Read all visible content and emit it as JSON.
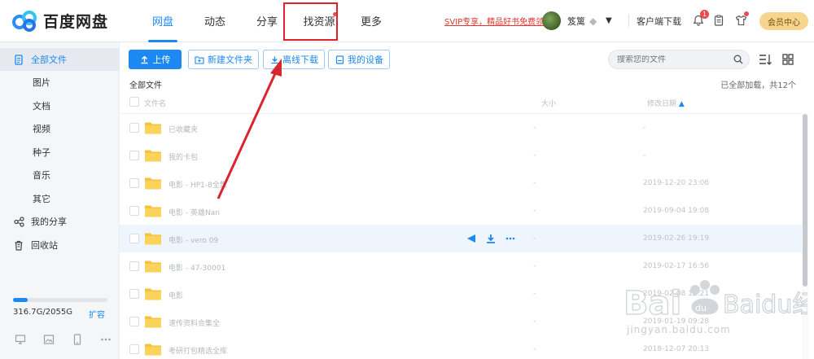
{
  "app": {
    "logo_text": "百度网盘"
  },
  "nav": {
    "items": [
      {
        "label": "网盘",
        "active": true
      },
      {
        "label": "动态"
      },
      {
        "label": "分享"
      },
      {
        "label": "找资源",
        "dot": true
      },
      {
        "label": "更多"
      }
    ]
  },
  "header": {
    "vip_promo": "SVIP专享，精品好书免费领",
    "username": "笈篱",
    "client_download": "客户端下载",
    "notification_count": "1",
    "vip_center": "会员中心"
  },
  "sidebar": {
    "items": [
      {
        "label": "全部文件",
        "active": true,
        "icon": "files-icon"
      },
      {
        "label": "图片",
        "sub": true
      },
      {
        "label": "文档",
        "sub": true
      },
      {
        "label": "视频",
        "sub": true
      },
      {
        "label": "种子",
        "sub": true
      },
      {
        "label": "音乐",
        "sub": true
      },
      {
        "label": "其它",
        "sub": true
      },
      {
        "label": "我的分享",
        "icon": "share-icon"
      },
      {
        "label": "回收站",
        "icon": "trash-icon"
      }
    ],
    "quota_text": "316.7G/2055G",
    "quota_fraction": 0.154,
    "expand_label": "扩容"
  },
  "toolbar": {
    "upload": "上传",
    "new_folder": "新建文件夹",
    "offline_download": "离线下载",
    "my_devices": "我的设备",
    "search_placeholder": "搜索您的文件"
  },
  "breadcrumb": "全部文件",
  "loaded_status": "已全部加载，共12个",
  "table": {
    "headers": {
      "name": "文件名",
      "size": "大小",
      "date": "修改日期"
    },
    "rows": [
      {
        "name": "已收藏夹",
        "size": "-",
        "date": "-"
      },
      {
        "name": "我的卡包",
        "size": "-",
        "date": "-"
      },
      {
        "name": "电影 - HP1-8全集",
        "size": "-",
        "date": "2019-12-20 23:06"
      },
      {
        "name": "电影 - 英雄Nan",
        "size": "-",
        "date": "2019-09-04 19:08"
      },
      {
        "name": "电影 - vero 09",
        "size": "-",
        "date": "2019-02-26 19:19"
      },
      {
        "name": "电影 - 47-30001",
        "size": "-",
        "date": "2019-02-17 16:56"
      },
      {
        "name": "电影",
        "size": "-",
        "date": "2019-02-08 12:21"
      },
      {
        "name": "速传资料合集全",
        "size": "-",
        "date": "2019-01-19 09:28"
      },
      {
        "name": "考研打包精选全库",
        "size": "-",
        "date": "2018-12-07 20:13"
      }
    ]
  },
  "watermark": {
    "brand": "Baidu经验",
    "url": "jingyan.baidu.com"
  },
  "colors": {
    "accent": "#1b89f1",
    "red": "#e0202a",
    "folder": "#f7c23b"
  }
}
